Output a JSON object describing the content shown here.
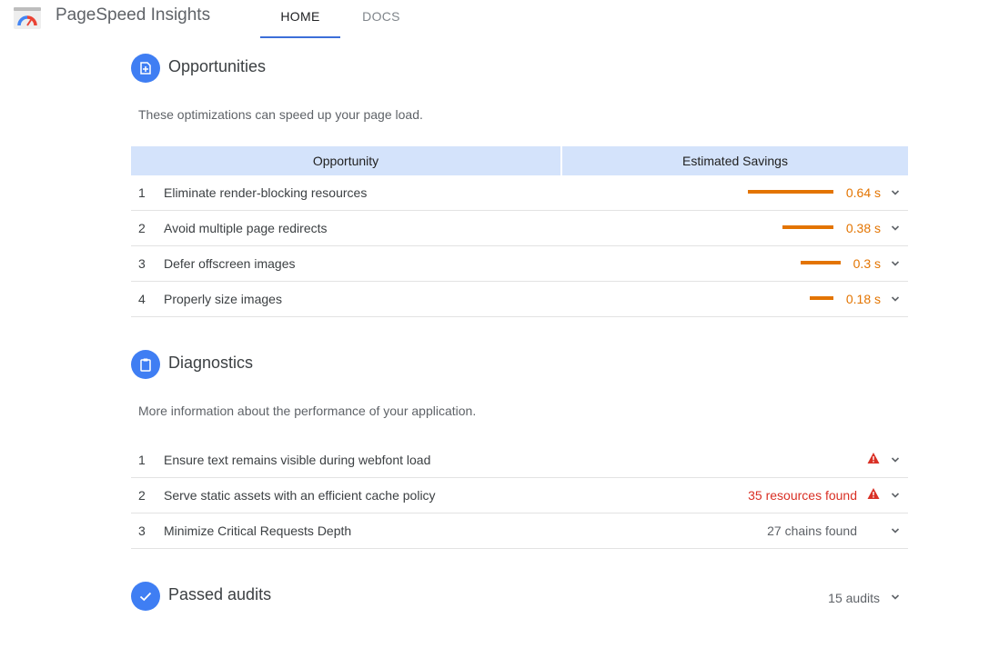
{
  "header": {
    "title": "PageSpeed Insights",
    "tabs": [
      {
        "label": "HOME",
        "active": true
      },
      {
        "label": "DOCS",
        "active": false
      }
    ]
  },
  "opportunities": {
    "title": "Opportunities",
    "description": "These optimizations can speed up your page load.",
    "columns": [
      "Opportunity",
      "Estimated Savings"
    ],
    "rows": [
      {
        "num": "1",
        "label": "Eliminate render-blocking resources",
        "savings": "0.64 s",
        "savings_seconds": 0.64
      },
      {
        "num": "2",
        "label": "Avoid multiple page redirects",
        "savings": "0.38 s",
        "savings_seconds": 0.38
      },
      {
        "num": "3",
        "label": "Defer offscreen images",
        "savings": "0.3 s",
        "savings_seconds": 0.3
      },
      {
        "num": "4",
        "label": "Properly size images",
        "savings": "0.18 s",
        "savings_seconds": 0.18
      }
    ]
  },
  "diagnostics": {
    "title": "Diagnostics",
    "description": "More information about the performance of your application.",
    "rows": [
      {
        "num": "1",
        "label": "Ensure text remains visible during webfont load",
        "detail": "",
        "warning": true
      },
      {
        "num": "2",
        "label": "Serve static assets with an efficient cache policy",
        "detail": "35 resources found",
        "warning": true
      },
      {
        "num": "3",
        "label": "Minimize Critical Requests Depth",
        "detail": "27 chains found",
        "warning": false
      }
    ]
  },
  "passed": {
    "title": "Passed audits",
    "count": "15 audits"
  },
  "colors": {
    "accent": "#3f7ef3",
    "savings": "#e37400",
    "warning": "#d93025",
    "table_header": "#d4e3fb"
  },
  "icons": {
    "logo": "pagespeed-gauge-icon",
    "opportunities": "page-plus-icon",
    "diagnostics": "clipboard-icon",
    "passed": "checkmark-icon",
    "expand": "chevron-down-icon",
    "warning": "warning-triangle-icon"
  }
}
